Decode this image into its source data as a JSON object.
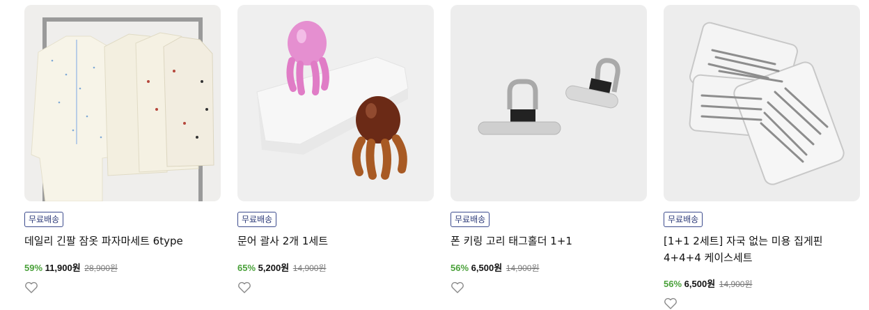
{
  "products": [
    {
      "badge": "무료배송",
      "title": "데일리 긴팔 잠옷 파자마세트 6type",
      "discount": "59%",
      "price": "11,900원",
      "original_price": "28,900원",
      "image": "pajama-set-photo"
    },
    {
      "badge": "무료배송",
      "title": "문어 괄사 2개 1세트",
      "discount": "65%",
      "price": "5,200원",
      "original_price": "14,900원",
      "image": "octopus-gua-sha-photo"
    },
    {
      "badge": "무료배송",
      "title": "폰 키링 고리 태그홀더 1+1",
      "discount": "56%",
      "price": "6,500원",
      "original_price": "14,900원",
      "image": "phone-tag-holder-photo"
    },
    {
      "badge": "무료배송",
      "title": "[1+1 2세트] 자국 없는 미용 집게핀 4+4+4 케이스세트",
      "discount": "56%",
      "price": "6,500원",
      "original_price": "14,900원",
      "image": "hair-clip-case-photo"
    }
  ],
  "colors": {
    "badge_border": "#3b4a8c",
    "discount": "#4aa13a",
    "thumb_bg": "#efefef"
  },
  "icons": {
    "wishlist": "heart-outline-icon"
  }
}
